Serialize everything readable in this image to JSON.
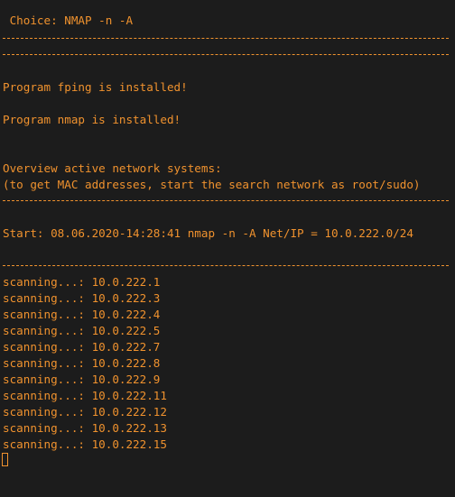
{
  "terminal": {
    "choice_line": " Choice: NMAP -n -A",
    "fping_line": "Program fping is installed!",
    "nmap_line": "Program nmap is installed!",
    "overview_line": "Overview active network systems:",
    "mac_hint_line": "(to get MAC addresses, start the search network as root/sudo)",
    "start_line": "Start: 08.06.2020-14:28:41 nmap -n -A Net/IP = 10.0.222.0/24",
    "scan_lines": [
      "scanning...: 10.0.222.1",
      "scanning...: 10.0.222.3",
      "scanning...: 10.0.222.4",
      "scanning...: 10.0.222.5",
      "scanning...: 10.0.222.7",
      "scanning...: 10.0.222.8",
      "scanning...: 10.0.222.9",
      "scanning...: 10.0.222.11",
      "scanning...: 10.0.222.12",
      "scanning...: 10.0.222.13",
      "scanning...: 10.0.222.15"
    ]
  },
  "colors": {
    "background": "#1c1c1c",
    "text": "#f0922e"
  }
}
